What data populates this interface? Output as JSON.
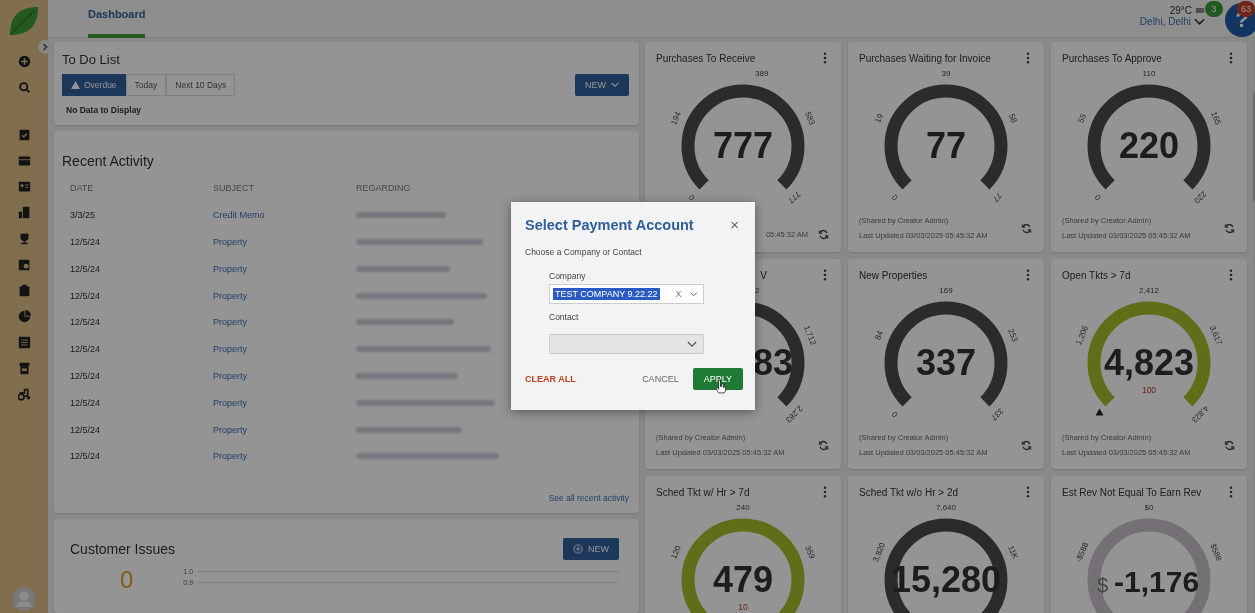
{
  "header": {
    "tab": {
      "label": "Dashboard",
      "selected": true
    },
    "weather": {
      "temp": "29°C",
      "location": "Delhi, Delhi"
    },
    "help": {
      "label": "?",
      "badges": [
        {
          "text": "3"
        },
        {
          "text": "63"
        }
      ]
    }
  },
  "todo": {
    "title": "To Do List",
    "tabs": [
      {
        "label": "Overdue",
        "selected": true
      },
      {
        "label": "Today",
        "selected": false
      },
      {
        "label": "Next 10 Days",
        "selected": false
      }
    ],
    "new_button": "NEW",
    "empty": "No Data to Display"
  },
  "activity": {
    "title": "Recent Activity",
    "columns": [
      "DATE",
      "SUBJECT",
      "REGARDING"
    ],
    "rows": [
      {
        "date": "3/3/25",
        "subject": "Credit Memo"
      },
      {
        "date": "12/5/24",
        "subject": "Property"
      },
      {
        "date": "12/5/24",
        "subject": "Property"
      },
      {
        "date": "12/5/24",
        "subject": "Property"
      },
      {
        "date": "12/5/24",
        "subject": "Property"
      },
      {
        "date": "12/5/24",
        "subject": "Property"
      },
      {
        "date": "12/5/24",
        "subject": "Property"
      },
      {
        "date": "12/5/24",
        "subject": "Property"
      },
      {
        "date": "12/5/24",
        "subject": "Property"
      },
      {
        "date": "12/5/24",
        "subject": "Property"
      }
    ],
    "link": "See all recent activity"
  },
  "issues": {
    "title": "Customer Issues",
    "new_button": "NEW",
    "count": "0",
    "axis_labels": [
      "1.0",
      "0.9"
    ]
  },
  "gauges": [
    {
      "title": "Purchases To Receive",
      "value": "777",
      "kind": "dark",
      "ticks": {
        "min": "0",
        "low": "194",
        "mid": "389",
        "high": "583",
        "max": "777"
      },
      "updated": "05:45:32 AM",
      "partial": true
    },
    {
      "title": "Purchases Waiting for Invoice",
      "value": "77",
      "kind": "dark",
      "ticks": {
        "min": "0",
        "low": "19",
        "mid": "39",
        "high": "58",
        "max": "77"
      },
      "shared": "(Shared by Creator Admin)",
      "updated": "Last Updated 03/03/2025 05:45:32 AM",
      "partial": false
    },
    {
      "title": "Purchases To Approve",
      "value": "220",
      "kind": "dark",
      "ticks": {
        "min": "0",
        "low": "55",
        "mid": "110",
        "high": "165",
        "max": "220"
      },
      "shared": "(Shared by Creator Admin)",
      "updated": "Last Updated 03/03/2025 05:45:32 AM",
      "partial": false
    },
    {
      "title": "V",
      "value": "83",
      "kind": "dark",
      "ticks": {
        "mid": "2",
        "high": "1,712",
        "max": "2,283"
      },
      "shared": "(Shared by Creator Admin)",
      "updated": "Last Updated 03/03/2025 05:45:32 AM",
      "partial": true
    },
    {
      "title": "New Properties",
      "value": "337",
      "kind": "dark",
      "ticks": {
        "min": "0",
        "low": "84",
        "mid": "169",
        "high": "253",
        "max": "337"
      },
      "shared": "(Shared by Creator Admin)",
      "updated": "Last Updated 03/03/2025 05:45:32 AM",
      "partial": false
    },
    {
      "title": "Open Tkts > 7d",
      "value": "4,823",
      "target": "100",
      "kind": "olive",
      "ticks": {
        "low": "1,206",
        "mid": "2,412",
        "high": "3,617",
        "max": "4,823"
      },
      "shared": "(Shared by Creator Admin)",
      "updated": "Last Updated 03/03/2025 05:45:32 AM",
      "partial": false
    },
    {
      "title": "Sched Tkt w/ Hr > 7d",
      "value": "479",
      "target": "10",
      "kind": "olive",
      "ticks": {
        "low": "120",
        "mid": "240",
        "high": "359"
      },
      "partial": false
    },
    {
      "title": "Sched Tkt w/o Hr > 2d",
      "value": "15,280",
      "kind": "dark",
      "ticks": {
        "low": "3,820",
        "mid": "7,640",
        "high": "11K"
      },
      "partial": false
    },
    {
      "title": "Est Rev Not Equal To Earn Rev",
      "value": "-1,176",
      "prefix": "$",
      "kind": "light",
      "ticks": {
        "low": "-$588",
        "mid": "$0",
        "high": "$588"
      },
      "partial": false
    }
  ],
  "dialog": {
    "title": "Select Payment Account",
    "close": "×",
    "instruction": "Choose a Company or Contact",
    "fields": [
      {
        "label": "Company",
        "value": "TEST COMPANY 9.22.22",
        "clear": "X"
      },
      {
        "label": "Contact"
      }
    ],
    "clear_all": "CLEAR ALL",
    "cancel": "CANCEL",
    "apply": "APPLY"
  }
}
